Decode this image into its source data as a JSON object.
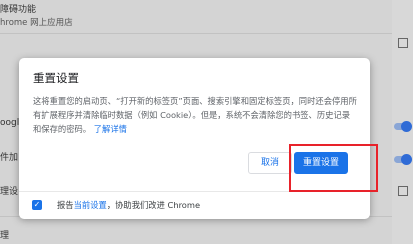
{
  "background": {
    "row1_title": "障碍功能",
    "row1_sub": "hrome 网上应用店",
    "row2_fragment": "oogl",
    "row3_fragment": "件加",
    "row4_fragment": "理设",
    "row5_fragment": "理"
  },
  "dialog": {
    "title": "重置设置",
    "body_text": "这将重置您的启动页、“打开新的标签页”页面、搜索引擎和固定标签页，同时还会停用所有扩展程序并清除临时数据（例如 Cookie）。但是，系统不会清除您的书签、历史记录和保存的密码。",
    "learn_more": "了解详情",
    "cancel_label": "取消",
    "reset_label": "重置设置",
    "footer_prefix": "报告",
    "footer_link": "当前设置",
    "footer_suffix": "，协助我们改进 Chrome",
    "checkbox_checked": true
  },
  "colors": {
    "accent": "#1a73e8",
    "highlight": "#e8222a"
  }
}
